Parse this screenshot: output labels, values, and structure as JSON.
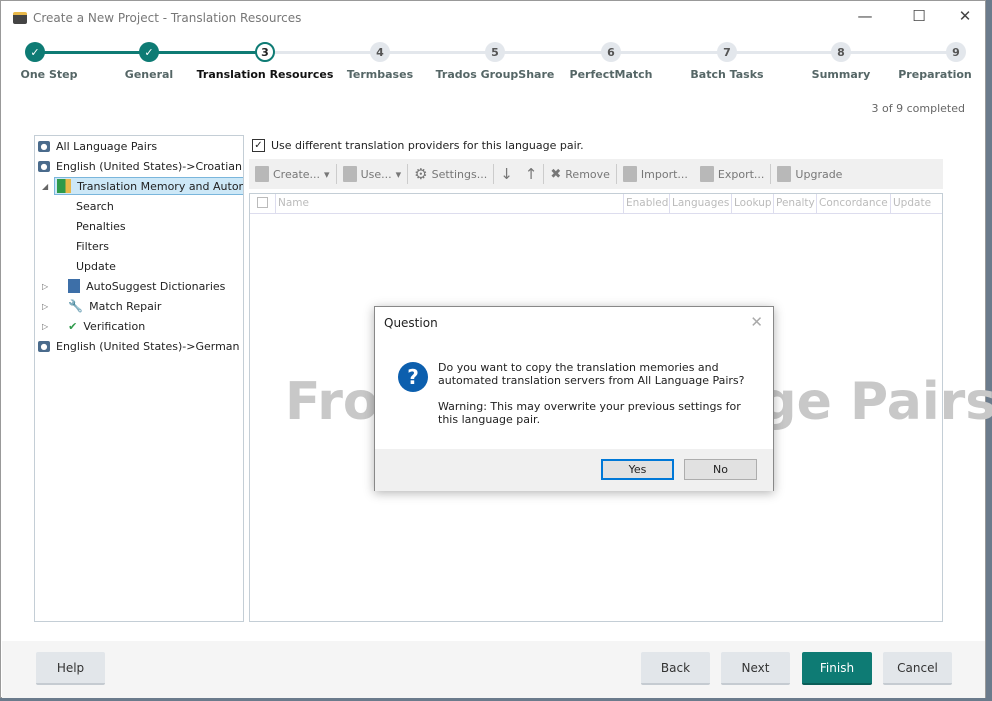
{
  "window": {
    "title": "Create a New Project - Translation Resources",
    "minimize": "—",
    "maximize": "☐",
    "close": "✕"
  },
  "steps": [
    {
      "num": "1",
      "label": "One Step",
      "state": "done"
    },
    {
      "num": "2",
      "label": "General",
      "state": "done"
    },
    {
      "num": "3",
      "label": "Translation Resources",
      "state": "current"
    },
    {
      "num": "4",
      "label": "Termbases",
      "state": "pending"
    },
    {
      "num": "5",
      "label": "Trados GroupShare",
      "state": "pending"
    },
    {
      "num": "6",
      "label": "PerfectMatch",
      "state": "pending"
    },
    {
      "num": "7",
      "label": "Batch Tasks",
      "state": "pending"
    },
    {
      "num": "8",
      "label": "Summary",
      "state": "pending"
    },
    {
      "num": "9",
      "label": "Preparation",
      "state": "pending"
    }
  ],
  "progress": "3 of 9 completed",
  "tree": {
    "items": [
      "All Language Pairs",
      "English (United States)->Croatian (Cr",
      "Translation Memory and Automa",
      "Search",
      "Penalties",
      "Filters",
      "Update",
      "AutoSuggest Dictionaries",
      "Match Repair",
      "Verification",
      "English (United States)->German (Ge"
    ]
  },
  "checkbox": {
    "label": "Use different translation providers for this language pair.",
    "checked": true
  },
  "toolbar": {
    "create": "Create...",
    "use": "Use...",
    "settings": "Settings...",
    "remove": "Remove",
    "import": "Import...",
    "export": "Export...",
    "upgrade": "Upgrade"
  },
  "table": {
    "columns": [
      "Name",
      "Enabled",
      "Languages",
      "Lookup",
      "Penalty",
      "Concordance",
      "Update"
    ]
  },
  "watermark": "From All Language Pairs",
  "dialog": {
    "title": "Question",
    "message": "Do you want to copy the translation memories and automated translation servers from All Language Pairs?",
    "warning": "Warning: This may overwrite your previous settings for this language pair.",
    "yes": "Yes",
    "no": "No"
  },
  "footer": {
    "help": "Help",
    "back": "Back",
    "next": "Next",
    "finish": "Finish",
    "cancel": "Cancel"
  },
  "colors": {
    "accent": "#0e7b74",
    "question_icon": "#0c5fae"
  }
}
